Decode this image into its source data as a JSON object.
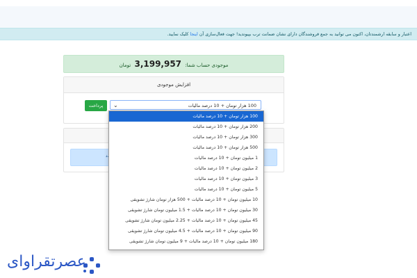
{
  "notice": {
    "text": "اعتبار و سابقه ارشمندتان، اکنون می توانید به جمع فروشندگان دارای نشان ضمانت ترب بپیوندید! جهت فعال‌سازی آن",
    "link": "اینجا",
    "suffix": "کلیک نمایید."
  },
  "balance": {
    "label": "موجودی حساب شما:",
    "amount": "3,199,957",
    "currency": "تومان"
  },
  "charge_card": {
    "title": "افزایش موجودی",
    "pay_button": "پرداخت",
    "selected": "100 هزار تومان + 10 درصد مالیات"
  },
  "info_box": {
    "text": "د."
  },
  "options": [
    "100 هزار تومان + 10 درصد مالیات",
    "200 هزار تومان + 10 درصد مالیات",
    "300 هزار تومان + 10 درصد مالیات",
    "500 هزار تومان + 10 درصد مالیات",
    "1 میلیون تومان + 10 درصد مالیات",
    "2 میلیون تومان + 10 درصد مالیات",
    "3 میلیون تومان + 10 درصد مالیات",
    "5 میلیون تومان + 10 درصد مالیات",
    "10 میلیون تومان + 10 درصد مالیات + 500 هزار تومان شارژ تشویقی",
    "30 میلیون تومان + 10 درصد مالیات + 1.5 میلیون تومان شارژ تشویقی",
    "45 میلیون تومان + 10 درصد مالیات + 2.25 میلیون تومان شارژ تشویقی",
    "90 میلیون تومان + 10 درصد مالیات + 4.5 میلیون تومان شارژ تشویقی",
    "180 میلیون تومان + 10 درصد مالیات + 9 میلیون تومان شارژ تشویقی"
  ],
  "logo": {
    "text": "عصرتقراوای"
  },
  "colors": {
    "accent": "#1967d2",
    "success": "#28a745",
    "brand": "#2b57c5"
  }
}
